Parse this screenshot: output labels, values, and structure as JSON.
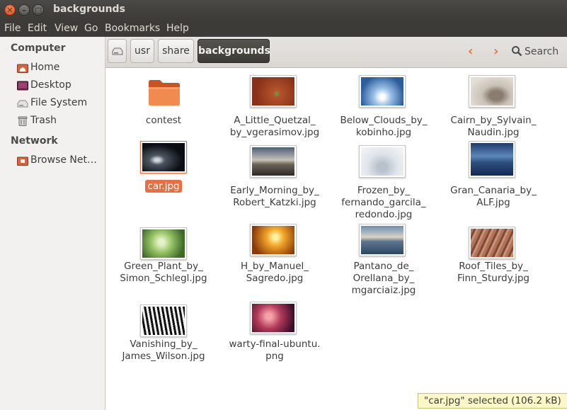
{
  "window": {
    "title": "backgrounds",
    "close_glyph": "✕",
    "min_glyph": "–",
    "max_glyph": "□"
  },
  "menu": [
    "File",
    "Edit",
    "View",
    "Go",
    "Bookmarks",
    "Help"
  ],
  "sidebar": {
    "computer_heading": "Computer",
    "computer_items": [
      {
        "label": "Home",
        "icon": "home-folder-icon"
      },
      {
        "label": "Desktop",
        "icon": "desktop-icon"
      },
      {
        "label": "File System",
        "icon": "drive-icon"
      },
      {
        "label": "Trash",
        "icon": "trash-icon"
      }
    ],
    "network_heading": "Network",
    "network_items": [
      {
        "label": "Browse Net…",
        "icon": "network-icon"
      }
    ]
  },
  "toolbar": {
    "breadcrumbs": [
      "usr",
      "share",
      "backgrounds"
    ],
    "back_glyph": "‹",
    "forward_glyph": "›",
    "search_label": "Search"
  },
  "files": [
    {
      "name": "contest",
      "lines": [
        "contest"
      ],
      "type": "folder"
    },
    {
      "name": "A_Little_Quetzal_by_vgerasimov.jpg",
      "lines": [
        "A_Little_Quetzal_",
        "by_vgerasimov.jpg"
      ]
    },
    {
      "name": "Below_Clouds_by_kobinho.jpg",
      "lines": [
        "Below_Clouds_by_",
        "kobinho.jpg"
      ]
    },
    {
      "name": "Cairn_by_Sylvain_Naudin.jpg",
      "lines": [
        "Cairn_by_Sylvain_",
        "Naudin.jpg"
      ]
    },
    {
      "name": "car.jpg",
      "lines": [
        "car.jpg"
      ],
      "selected": true
    },
    {
      "name": "Early_Morning_by_Robert_Katzki.jpg",
      "lines": [
        "Early_Morning_by_",
        "Robert_Katzki.jpg"
      ]
    },
    {
      "name": "Frozen_by_fernando_garcila_redondo.jpg",
      "lines": [
        "Frozen_by_",
        "fernando_garcila_",
        "redondo.jpg"
      ]
    },
    {
      "name": "Gran_Canaria_by_ALF.jpg",
      "lines": [
        "Gran_Canaria_by_",
        "ALF.jpg"
      ]
    },
    {
      "name": "Green_Plant_by_Simon_Schlegl.jpg",
      "lines": [
        "Green_Plant_by_",
        "Simon_Schlegl.jpg"
      ]
    },
    {
      "name": "H_by_Manuel_Sagredo.jpg",
      "lines": [
        "H_by_Manuel_",
        "Sagredo.jpg"
      ]
    },
    {
      "name": "Pantano_de_Orellana_by_mgarciaiz.jpg",
      "lines": [
        "Pantano_de_",
        "Orellana_by_",
        "mgarciaiz.jpg"
      ]
    },
    {
      "name": "Roof_Tiles_by_Finn_Sturdy.jpg",
      "lines": [
        "Roof_Tiles_by_",
        "Finn_Sturdy.jpg"
      ]
    },
    {
      "name": "Vanishing_by_James_Wilson.jpg",
      "lines": [
        "Vanishing_by_",
        "James_Wilson.jpg"
      ]
    },
    {
      "name": "warty-final-ubuntu.png",
      "lines": [
        "warty-final-ubuntu.",
        "png"
      ]
    }
  ],
  "status": "\"car.jpg\" selected (106.2 kB)",
  "colors": {
    "accent": "#e96f42",
    "titlebar": "#3c3b37"
  }
}
